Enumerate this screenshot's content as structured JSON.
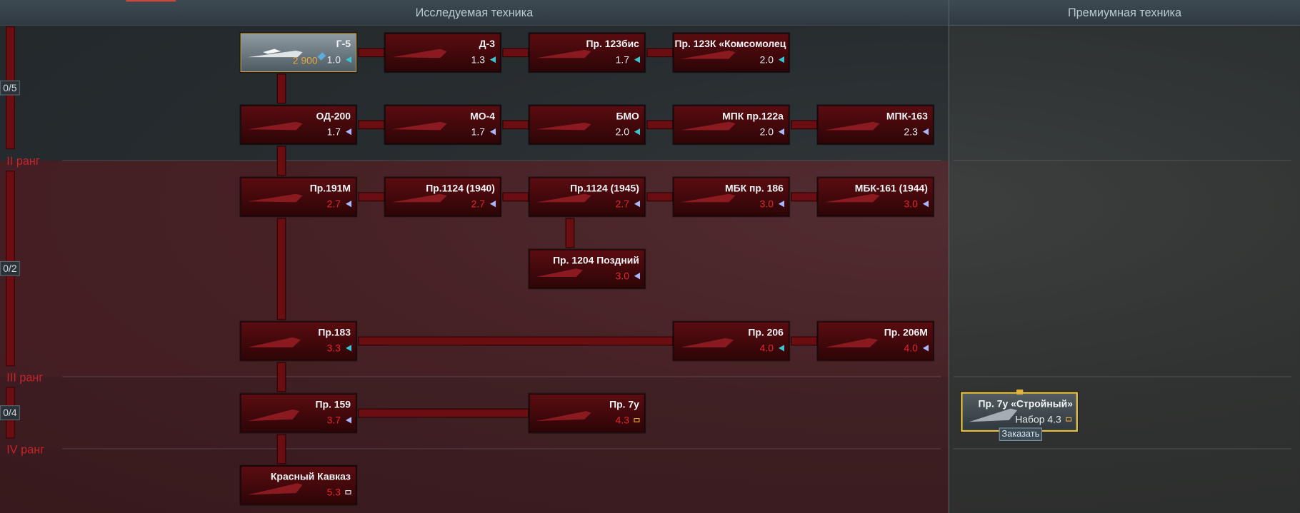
{
  "headers": {
    "research": "Исследуемая техника",
    "premium": "Премиумная техника"
  },
  "ranks": [
    {
      "label": "II ранг",
      "count": "0/5"
    },
    {
      "label": "III ранг",
      "count": "0/2"
    },
    {
      "label": "IV ранг",
      "count": "0/4"
    }
  ],
  "colors": {
    "br_white": "#e5ebee",
    "br_red": "#e4262e",
    "cost": "#e2a63b",
    "premium_border": "#e6c03a",
    "rank_label": "#c8232b"
  },
  "vehicles": [
    {
      "name": "Г-5",
      "br": "1.0",
      "cost": "2 900",
      "icon": "cyan-arrow-icon",
      "state": "owned"
    },
    {
      "name": "Д-3",
      "br": "1.3",
      "icon": "cyan-arrow-icon"
    },
    {
      "name": "Пр. 123бис",
      "br": "1.7",
      "icon": "cyan-arrow-icon"
    },
    {
      "name": "Пр. 123К «Комсомолец",
      "br": "2.0",
      "icon": "cyan-arrow-icon"
    },
    {
      "name": "ОД-200",
      "br": "1.7",
      "icon": "blue-arrow-icon"
    },
    {
      "name": "МО-4",
      "br": "1.7",
      "icon": "blue-arrow-icon"
    },
    {
      "name": "БМО",
      "br": "2.0",
      "icon": "cyan-arrow-icon"
    },
    {
      "name": "МПК пр.122а",
      "br": "2.0",
      "icon": "blue-arrow-icon"
    },
    {
      "name": "МПК-163",
      "br": "2.3",
      "icon": "blue-arrow-icon"
    },
    {
      "name": "Пр.191М",
      "br": "2.7",
      "icon": "blue-arrow-icon"
    },
    {
      "name": "Пр.1124 (1940)",
      "br": "2.7",
      "icon": "blue-arrow-icon"
    },
    {
      "name": "Пр.1124 (1945)",
      "br": "2.7",
      "icon": "blue-arrow-icon"
    },
    {
      "name": "МБК пр. 186",
      "br": "3.0",
      "icon": "blue-arrow-icon"
    },
    {
      "name": "МБК-161 (1944)",
      "br": "3.0",
      "icon": "blue-arrow-icon"
    },
    {
      "name": "Пр. 1204 Поздний",
      "br": "3.0",
      "icon": "blue-arrow-icon"
    },
    {
      "name": "Пр.183",
      "br": "3.3",
      "icon": "cyan-arrow-icon"
    },
    {
      "name": "Пр. 206",
      "br": "4.0",
      "icon": "cyan-arrow-icon"
    },
    {
      "name": "Пр. 206М",
      "br": "4.0",
      "icon": "blue-arrow-icon"
    },
    {
      "name": "Пр. 159",
      "br": "3.7",
      "icon": "blue-arrow-icon"
    },
    {
      "name": "Пр. 7у",
      "br": "4.3",
      "icon": "destroyer-class-icon"
    },
    {
      "name": "Красный Кавказ",
      "br": "5.3",
      "icon": "cruiser-class-icon"
    }
  ],
  "premium_vehicle": {
    "name": "Пр. 7у «Стройный»",
    "br": "Набор 4.3",
    "icon": "destroyer-class-icon",
    "order_label": "Заказать"
  }
}
